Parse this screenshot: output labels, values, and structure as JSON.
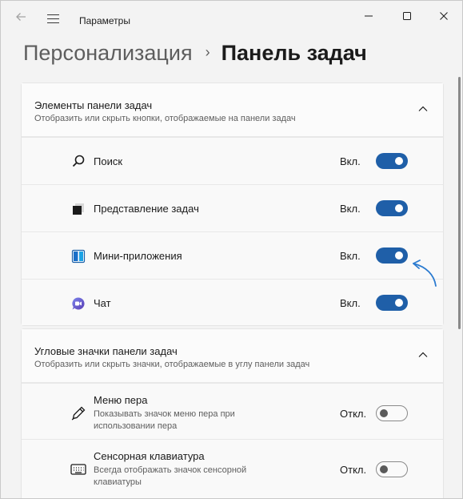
{
  "window": {
    "title": "Параметры"
  },
  "header": {
    "parent": "Персонализация",
    "separator": "›",
    "current": "Панель задач"
  },
  "section1": {
    "title": "Элементы панели задач",
    "subtitle": "Отобразить или скрыть кнопки, отображаемые на панели задач",
    "items": [
      {
        "label": "Поиск",
        "state": "Вкл.",
        "on": true,
        "icon": "search-icon"
      },
      {
        "label": "Представление задач",
        "state": "Вкл.",
        "on": true,
        "icon": "task-view-icon"
      },
      {
        "label": "Мини-приложения",
        "state": "Вкл.",
        "on": true,
        "icon": "widgets-icon"
      },
      {
        "label": "Чат",
        "state": "Вкл.",
        "on": true,
        "icon": "chat-icon"
      }
    ]
  },
  "section2": {
    "title": "Угловые значки панели задач",
    "subtitle": "Отобразить или скрыть значки, отображаемые в углу панели задач",
    "items": [
      {
        "label": "Меню пера",
        "description": "Показывать значок меню пера при использовании пера",
        "state": "Откл.",
        "on": false,
        "icon": "pen-icon"
      },
      {
        "label": "Сенсорная клавиатура",
        "description": "Всегда отображать значок сенсорной клавиатуры",
        "state": "Откл.",
        "on": false,
        "icon": "keyboard-icon"
      }
    ]
  },
  "colors": {
    "accent": "#1f5fa8",
    "annotation_arrow": "#2b7bd0"
  }
}
